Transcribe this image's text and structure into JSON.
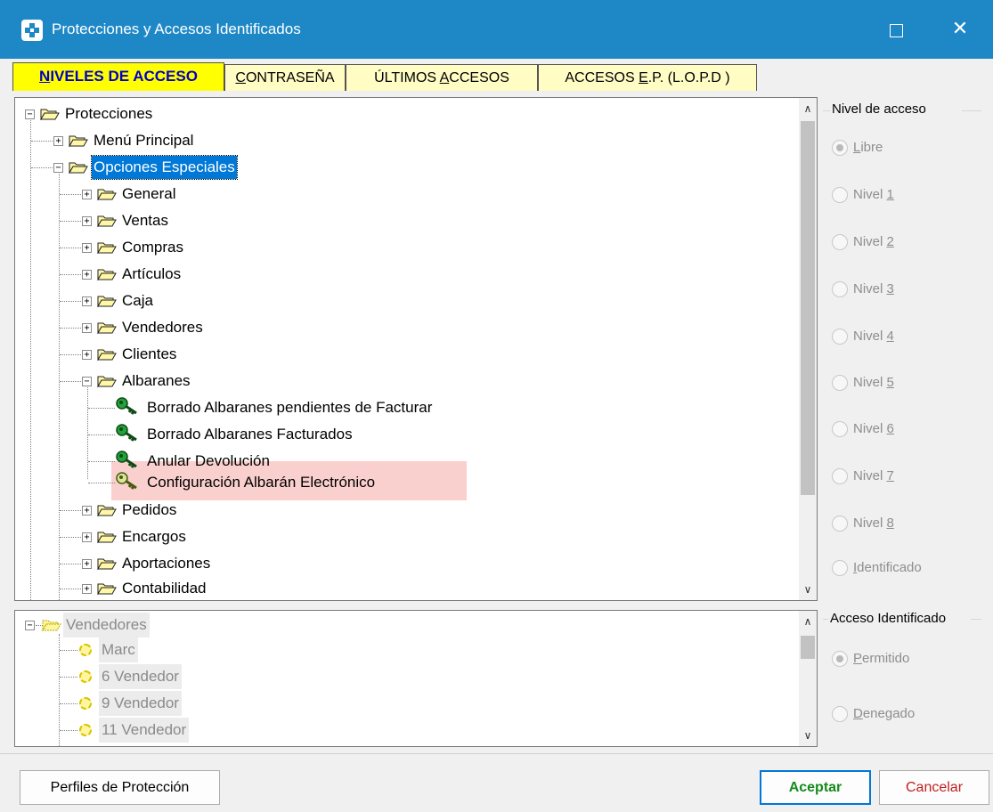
{
  "window": {
    "title": "Protecciones y Accesos Identificados",
    "maximize_glyph": "☐",
    "close_glyph": "✕"
  },
  "tabs": [
    {
      "label_pre": "",
      "label_ul": "N",
      "label_post": "IVELES DE ACCESO",
      "active": true
    },
    {
      "label_pre": "",
      "label_ul": "C",
      "label_post": "ONTRASEÑA",
      "active": false
    },
    {
      "label_pre": "ÚLTIMOS ",
      "label_ul": "A",
      "label_post": "CCESOS",
      "active": false
    },
    {
      "label_pre": "ACCESOS ",
      "label_ul": "E",
      "label_post": ".P. (L.O.P.D )",
      "active": false
    }
  ],
  "tree": {
    "root": "Protecciones",
    "menu_principal": "Menú Principal",
    "opciones_especiales": "Opciones Especiales",
    "general": "General",
    "ventas": "Ventas",
    "compras": "Compras",
    "articulos": "Artículos",
    "caja": "Caja",
    "vendedores": "Vendedores",
    "clientes": "Clientes",
    "albaranes": "Albaranes",
    "borrado_pendientes": "Borrado Albaranes pendientes de Facturar",
    "borrado_facturados": "Borrado Albaranes Facturados",
    "anular_devolucion": "Anular Devolución",
    "configuracion_albaran": "Configuración Albarán Electrónico",
    "pedidos": "Pedidos",
    "encargos": "Encargos",
    "aportaciones": "Aportaciones",
    "contabilidad": "Contabilidad"
  },
  "vendedores_tree": {
    "root": "Vendedores",
    "items": [
      "Marc",
      "6 Vendedor",
      "9 Vendedor",
      "11 Vendedor"
    ]
  },
  "nivel_acceso": {
    "title": "Nivel de acceso",
    "options": [
      {
        "pre": "",
        "ul": "L",
        "post": "ibre",
        "selected": true
      },
      {
        "pre": "Nivel ",
        "ul": "1",
        "post": "",
        "selected": false
      },
      {
        "pre": "Nivel ",
        "ul": "2",
        "post": "",
        "selected": false
      },
      {
        "pre": "Nivel ",
        "ul": "3",
        "post": "",
        "selected": false
      },
      {
        "pre": "Nivel ",
        "ul": "4",
        "post": "",
        "selected": false
      },
      {
        "pre": "Nivel ",
        "ul": "5",
        "post": "",
        "selected": false
      },
      {
        "pre": "Nivel ",
        "ul": "6",
        "post": "",
        "selected": false
      },
      {
        "pre": "Nivel ",
        "ul": "7",
        "post": "",
        "selected": false
      },
      {
        "pre": "Nivel ",
        "ul": "8",
        "post": "",
        "selected": false
      },
      {
        "pre": "",
        "ul": "I",
        "post": "dentificado",
        "selected": false
      }
    ]
  },
  "acceso_identificado": {
    "title": "Acceso Identificado",
    "options": [
      {
        "pre": "",
        "ul": "P",
        "post": "ermitido",
        "selected": true
      },
      {
        "pre": "",
        "ul": "D",
        "post": "enegado",
        "selected": false
      }
    ]
  },
  "buttons": {
    "perfiles": "Perfiles de Protección",
    "aceptar": "Aceptar",
    "cancelar": "Cancelar"
  },
  "scroll": {
    "up": "∧",
    "down": "∨"
  },
  "colors": {
    "titlebar": "#1e88c7",
    "active_tab": "#ffff00",
    "inactive_tab": "#fffcc4",
    "selection": "#0078d7",
    "highlight_row": "#f9d0ce",
    "aceptar_text": "#168a1c",
    "cancelar_text": "#c02020"
  }
}
